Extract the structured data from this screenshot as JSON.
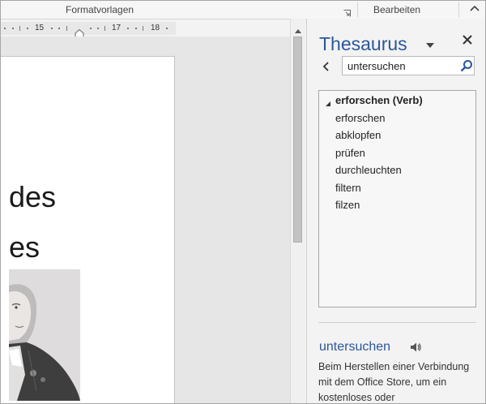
{
  "ribbon": {
    "group_formatvorlagen": "Formatvorlagen",
    "group_bearbeiten": "Bearbeiten"
  },
  "ruler": {
    "labels": [
      "15",
      "17",
      "18"
    ]
  },
  "document": {
    "line1": "des",
    "line2": "es"
  },
  "thesaurus": {
    "title": "Thesaurus",
    "search_value": "untersuchen",
    "results": {
      "header": "erforschen (Verb)",
      "items": [
        "erforschen",
        "abklopfen",
        "prüfen",
        "durchleuchten",
        "filtern",
        "filzen"
      ]
    },
    "word": "untersuchen",
    "description": "Beim Herstellen einer Verbindung mit dem Office Store, um ein kostenloses oder"
  },
  "colors": {
    "accent": "#2b579a",
    "pane_bg": "#f3f3f3",
    "ruler_bg": "#e8e8e8"
  },
  "icons": [
    "dialog-launcher-icon",
    "collapse-ribbon-icon",
    "indent-marker-icon",
    "scroll-up-icon",
    "pane-menu-icon",
    "close-icon",
    "back-icon",
    "search-icon",
    "expand-caret-icon",
    "speaker-icon"
  ]
}
